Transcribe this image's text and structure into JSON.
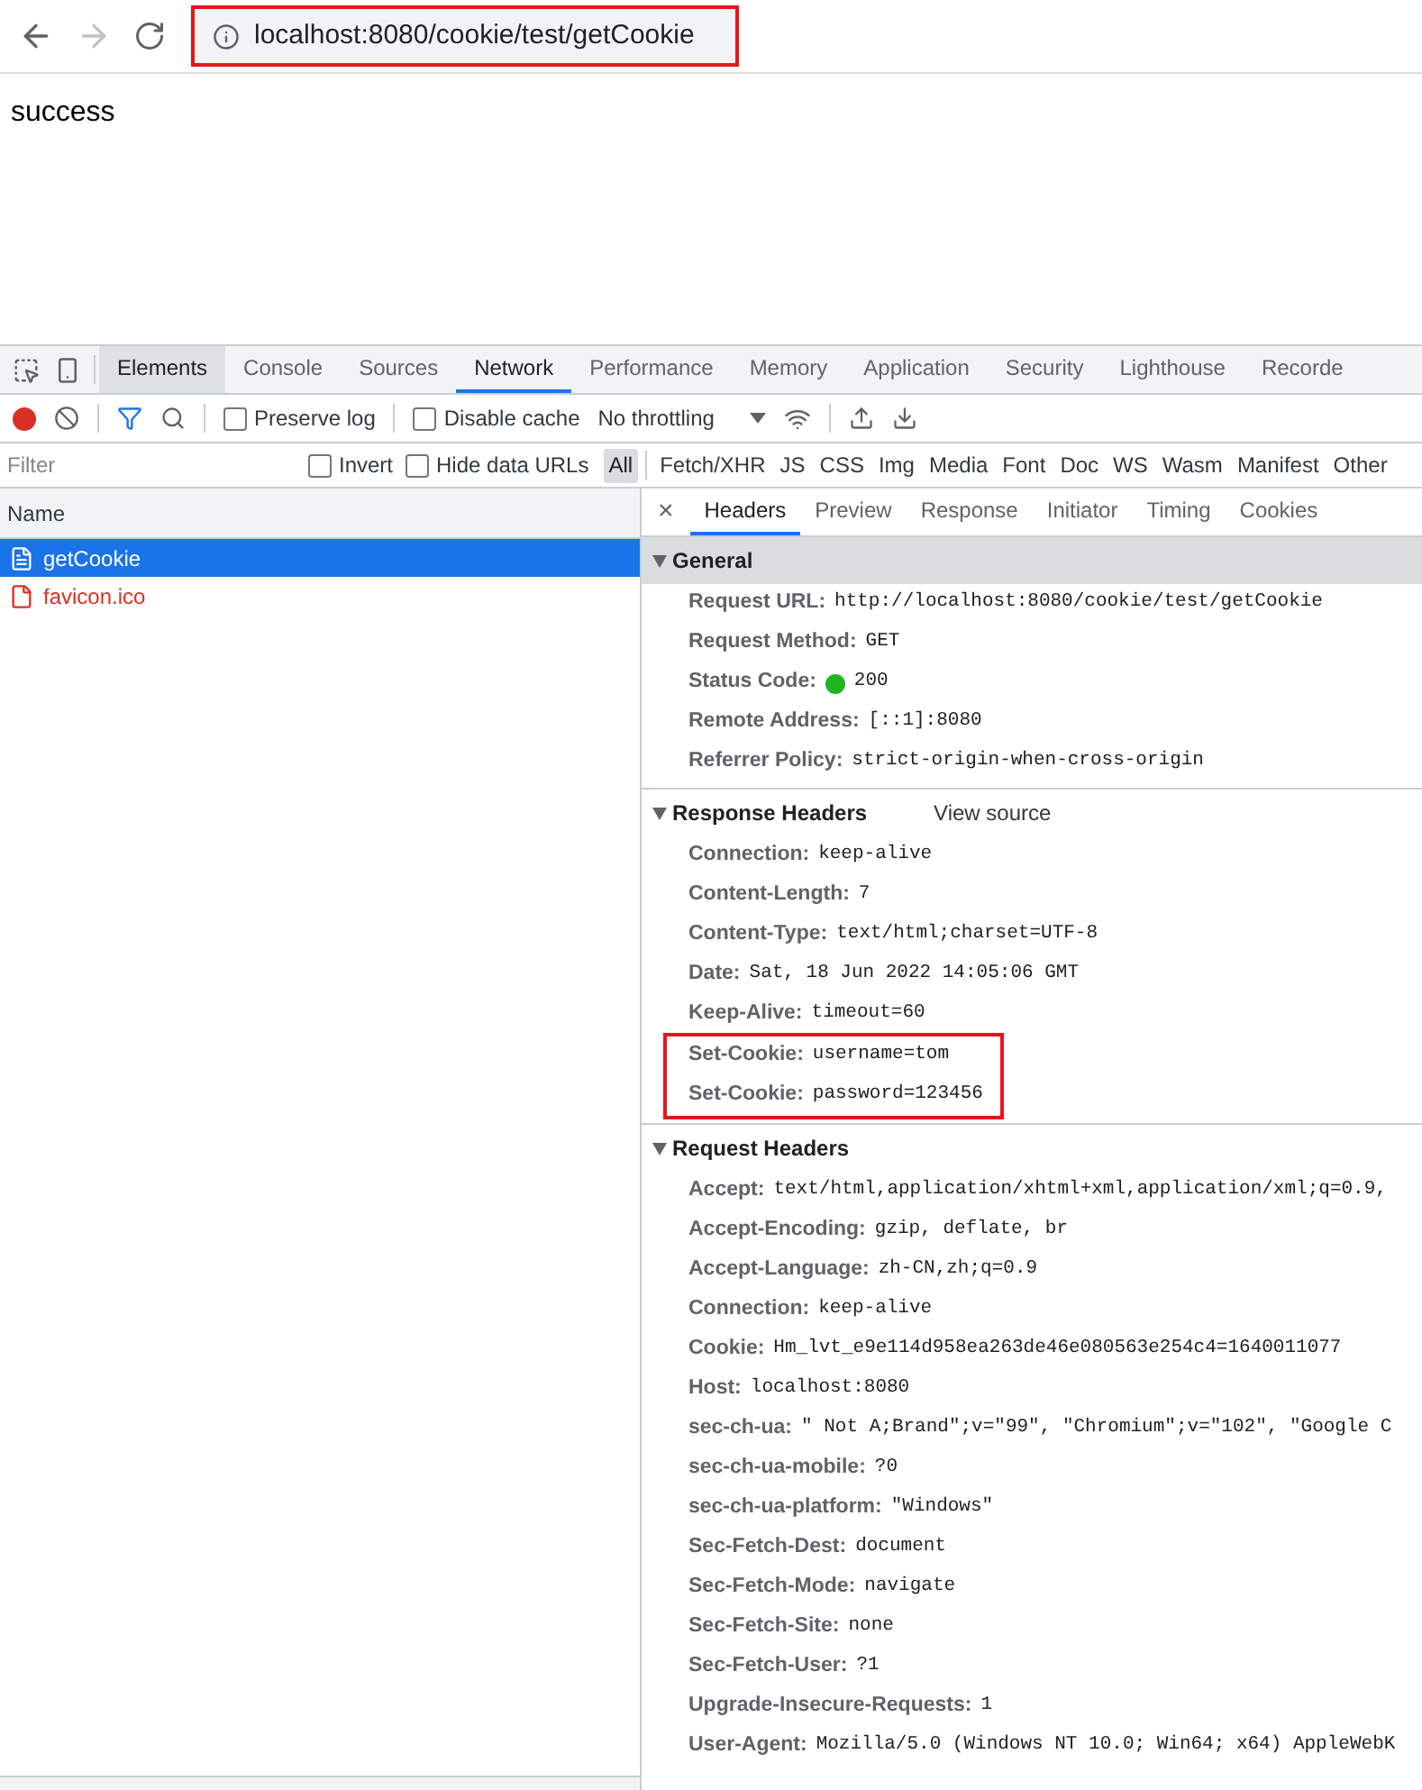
{
  "browser": {
    "url": "localhost:8080/cookie/test/getCookie",
    "url_highlighted": true
  },
  "page": {
    "text": "success"
  },
  "devtools": {
    "panel_tabs": [
      {
        "label": "Elements",
        "selected": false,
        "hovered": true
      },
      {
        "label": "Console",
        "selected": false,
        "hovered": false
      },
      {
        "label": "Sources",
        "selected": false,
        "hovered": false
      },
      {
        "label": "Network",
        "selected": true,
        "hovered": false
      },
      {
        "label": "Performance",
        "selected": false,
        "hovered": false
      },
      {
        "label": "Memory",
        "selected": false,
        "hovered": false
      },
      {
        "label": "Application",
        "selected": false,
        "hovered": false
      },
      {
        "label": "Security",
        "selected": false,
        "hovered": false
      },
      {
        "label": "Lighthouse",
        "selected": false,
        "hovered": false
      },
      {
        "label": "Recorde",
        "selected": false,
        "hovered": false
      }
    ],
    "toolbar": {
      "recording": true,
      "preserve_log": {
        "label": "Preserve log",
        "checked": false
      },
      "disable_cache": {
        "label": "Disable cache",
        "checked": false
      },
      "throttling": "No throttling"
    },
    "filter": {
      "placeholder": "Filter",
      "invert": {
        "label": "Invert",
        "checked": false
      },
      "hide_data_urls": {
        "label": "Hide data URLs",
        "checked": false
      },
      "types": [
        {
          "label": "All",
          "selected": true
        },
        {
          "label": "Fetch/XHR",
          "selected": false
        },
        {
          "label": "JS",
          "selected": false
        },
        {
          "label": "CSS",
          "selected": false
        },
        {
          "label": "Img",
          "selected": false
        },
        {
          "label": "Media",
          "selected": false
        },
        {
          "label": "Font",
          "selected": false
        },
        {
          "label": "Doc",
          "selected": false
        },
        {
          "label": "WS",
          "selected": false
        },
        {
          "label": "Wasm",
          "selected": false
        },
        {
          "label": "Manifest",
          "selected": false
        },
        {
          "label": "Other",
          "selected": false
        }
      ]
    },
    "requests": {
      "column": "Name",
      "rows": [
        {
          "name": "getCookie",
          "selected": true,
          "failed": false
        },
        {
          "name": "favicon.ico",
          "selected": false,
          "failed": true
        }
      ]
    },
    "detail": {
      "close": "×",
      "tabs": [
        {
          "label": "Headers",
          "selected": true
        },
        {
          "label": "Preview",
          "selected": false
        },
        {
          "label": "Response",
          "selected": false
        },
        {
          "label": "Initiator",
          "selected": false
        },
        {
          "label": "Timing",
          "selected": false
        },
        {
          "label": "Cookies",
          "selected": false
        }
      ],
      "sections": [
        {
          "title": "General",
          "expanded": true,
          "shaded": true,
          "rows": [
            {
              "name": "Request URL:",
              "value": "http://localhost:8080/cookie/test/getCookie",
              "highlighted": false
            },
            {
              "name": "Request Method:",
              "value": "GET",
              "highlighted": false
            },
            {
              "name": "Status Code:",
              "value": "200",
              "color": "#1fb51f",
              "highlighted": false
            },
            {
              "name": "Remote Address:",
              "value": "[::1]:8080",
              "highlighted": false
            },
            {
              "name": "Referrer Policy:",
              "value": "strict-origin-when-cross-origin",
              "highlighted": false
            }
          ]
        },
        {
          "title": "Response Headers",
          "expanded": true,
          "shaded": false,
          "link": "View source",
          "rows": [
            {
              "name": "Connection:",
              "value": "keep-alive",
              "highlighted": false
            },
            {
              "name": "Content-Length:",
              "value": "7",
              "highlighted": false
            },
            {
              "name": "Content-Type:",
              "value": "text/html;charset=UTF-8",
              "highlighted": false
            },
            {
              "name": "Date:",
              "value": "Sat, 18 Jun 2022 14:05:06 GMT",
              "highlighted": false
            },
            {
              "name": "Keep-Alive:",
              "value": "timeout=60",
              "highlighted": false
            },
            {
              "name": "Set-Cookie:",
              "value": "username=tom",
              "highlighted": true
            },
            {
              "name": "Set-Cookie:",
              "value": "password=123456",
              "highlighted": true
            }
          ]
        },
        {
          "title": "Request Headers",
          "expanded": true,
          "shaded": false,
          "rows": [
            {
              "name": "Accept:",
              "value": "text/html,application/xhtml+xml,application/xml;q=0.9,",
              "highlighted": false
            },
            {
              "name": "Accept-Encoding:",
              "value": "gzip, deflate, br",
              "highlighted": false
            },
            {
              "name": "Accept-Language:",
              "value": "zh-CN,zh;q=0.9",
              "highlighted": false
            },
            {
              "name": "Connection:",
              "value": "keep-alive",
              "highlighted": false
            },
            {
              "name": "Cookie:",
              "value": "Hm_lvt_e9e114d958ea263de46e080563e254c4=1640011077",
              "highlighted": false
            },
            {
              "name": "Host:",
              "value": "localhost:8080",
              "highlighted": false
            },
            {
              "name": "sec-ch-ua:",
              "value": "\" Not A;Brand\";v=\"99\", \"Chromium\";v=\"102\", \"Google C",
              "highlighted": false
            },
            {
              "name": "sec-ch-ua-mobile:",
              "value": "?0",
              "highlighted": false
            },
            {
              "name": "sec-ch-ua-platform:",
              "value": "\"Windows\"",
              "highlighted": false
            },
            {
              "name": "Sec-Fetch-Dest:",
              "value": "document",
              "highlighted": false
            },
            {
              "name": "Sec-Fetch-Mode:",
              "value": "navigate",
              "highlighted": false
            },
            {
              "name": "Sec-Fetch-Site:",
              "value": "none",
              "highlighted": false
            },
            {
              "name": "Sec-Fetch-User:",
              "value": "?1",
              "highlighted": false
            },
            {
              "name": "Upgrade-Insecure-Requests:",
              "value": "1",
              "highlighted": false
            },
            {
              "name": "User-Agent:",
              "value": "Mozilla/5.0 (Windows NT 10.0; Win64; x64) AppleWebK",
              "highlighted": false
            }
          ]
        }
      ]
    }
  }
}
